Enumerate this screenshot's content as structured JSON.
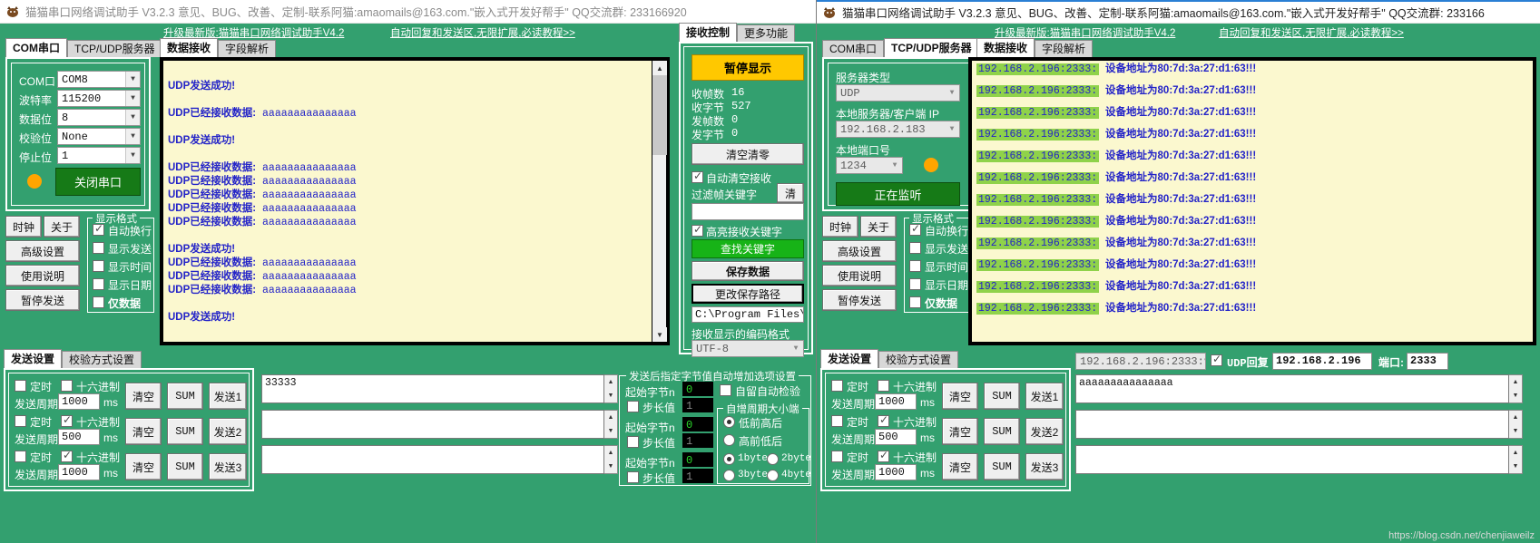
{
  "window_left": {
    "title": "猫猫串口网络调试助手 V3.2.3 意见、BUG、改善、定制-联系阿猫:amaomails@163.com.\"嵌入式开发好帮手\" QQ交流群: 233166920",
    "banner": {
      "upgrade_link": "升级最新版:猫猫串口网络调试助手V4.2",
      "auto_reply_link": "自动回复和发送区,无限扩展,必读教程>>"
    },
    "conn_tabs": [
      {
        "label": "COM串口",
        "active": true
      },
      {
        "label": "TCP/UDP服务器",
        "active": false
      }
    ],
    "serial": {
      "fields": [
        {
          "label": "COM口",
          "value": "COM8"
        },
        {
          "label": "波特率",
          "value": "115200"
        },
        {
          "label": "数据位",
          "value": "8"
        },
        {
          "label": "校验位",
          "value": "None"
        },
        {
          "label": "停止位",
          "value": "1"
        }
      ],
      "connect_button": "关闭串口",
      "led_color": "#ffa500"
    },
    "side_buttons": [
      "时钟",
      "关于",
      "高级设置",
      "使用说明",
      "暂停发送"
    ],
    "display_format": {
      "title": "显示格式",
      "options": [
        {
          "label": "自动换行",
          "checked": true
        },
        {
          "label": "显示发送",
          "checked": false
        },
        {
          "label": "显示时间",
          "checked": false
        },
        {
          "label": "显示日期",
          "checked": false
        },
        {
          "label": "仅数据",
          "checked": false,
          "bold": true
        }
      ]
    },
    "data_tabs": [
      {
        "label": "数据接收",
        "active": true
      },
      {
        "label": "字段解析",
        "active": false
      }
    ],
    "log_lines": [
      {
        "type": "blank"
      },
      {
        "type": "send",
        "text": "UDP发送成功!"
      },
      {
        "type": "blank"
      },
      {
        "type": "recv",
        "prefix": "UDP已经接收数据:",
        "data": "aaaaaaaaaaaaaaa"
      },
      {
        "type": "blank"
      },
      {
        "type": "send",
        "text": "UDP发送成功!"
      },
      {
        "type": "blank"
      },
      {
        "type": "recv",
        "prefix": "UDP已经接收数据:",
        "data": "aaaaaaaaaaaaaaa"
      },
      {
        "type": "recv",
        "prefix": "UDP已经接收数据:",
        "data": "aaaaaaaaaaaaaaa"
      },
      {
        "type": "recv",
        "prefix": "UDP已经接收数据:",
        "data": "aaaaaaaaaaaaaaa"
      },
      {
        "type": "recv",
        "prefix": "UDP已经接收数据:",
        "data": "aaaaaaaaaaaaaaa"
      },
      {
        "type": "recv",
        "prefix": "UDP已经接收数据:",
        "data": "aaaaaaaaaaaaaaa"
      },
      {
        "type": "blank"
      },
      {
        "type": "send",
        "text": "UDP发送成功!"
      },
      {
        "type": "recv",
        "prefix": "UDP已经接收数据:",
        "data": "aaaaaaaaaaaaaaa"
      },
      {
        "type": "recv",
        "prefix": "UDP已经接收数据:",
        "data": "aaaaaaaaaaaaaaa"
      },
      {
        "type": "recv",
        "prefix": "UDP已经接收数据:",
        "data": "aaaaaaaaaaaaaaa"
      },
      {
        "type": "blank"
      },
      {
        "type": "send",
        "text": "UDP发送成功!"
      }
    ],
    "recv_tabs": [
      {
        "label": "接收控制",
        "active": true
      },
      {
        "label": "更多功能",
        "active": false
      }
    ],
    "recv_ctrl": {
      "pause_button": "暂停显示",
      "stats": [
        {
          "label": "收帧数",
          "value": "16"
        },
        {
          "label": "收字节",
          "value": "527"
        },
        {
          "label": "发帧数",
          "value": "0"
        },
        {
          "label": "发字节",
          "value": "0"
        }
      ],
      "clear_button": "清空清零",
      "auto_clear": {
        "label": "自动清空接收",
        "checked": true
      },
      "filter_label": "过滤帧关键字",
      "filter_clear_button": "清",
      "filter_value": "",
      "highlight": {
        "label": "高亮接收关键字",
        "checked": true
      },
      "find_button": "查找关键字",
      "save_button": "保存数据",
      "path_button": "更改保存路径",
      "path_value": "C:\\Program Files\\dat",
      "encoding_label": "接收显示的编码格式",
      "encoding_value": "UTF-8"
    },
    "bottom_tabs": [
      {
        "label": "发送设置",
        "active": true
      },
      {
        "label": "校验方式设置",
        "active": false
      }
    ],
    "send_rows": [
      {
        "timer": {
          "label": "定时",
          "checked": false
        },
        "hex": {
          "label": "十六进制",
          "checked": false
        },
        "period_label": "发送周期",
        "period": "1000",
        "unit": "ms",
        "clear": "清空",
        "sum": "SUM",
        "send": "发送1",
        "payload": "33333"
      },
      {
        "timer": {
          "label": "定时",
          "checked": false
        },
        "hex": {
          "label": "十六进制",
          "checked": true
        },
        "period_label": "发送周期",
        "period": "500",
        "unit": "ms",
        "clear": "清空",
        "sum": "SUM",
        "send": "发送2",
        "payload": ""
      },
      {
        "timer": {
          "label": "定时",
          "checked": false
        },
        "hex": {
          "label": "十六进制",
          "checked": true
        },
        "period_label": "发送周期",
        "period": "1000",
        "unit": "ms",
        "clear": "清空",
        "sum": "SUM",
        "send": "发送3",
        "payload": ""
      }
    ],
    "auto_inc": {
      "title": "发送后指定字节值自动增加选项设置",
      "rows": [
        {
          "start_label": "起始字节n",
          "start": "0",
          "step_label": "步长值",
          "step": "1",
          "step_checked": false
        },
        {
          "start_label": "起始字节n",
          "start": "0",
          "step_label": "步长值",
          "step": "1",
          "step_checked": false
        },
        {
          "start_label": "起始字节n",
          "start": "0",
          "step_label": "步长值",
          "step": "1",
          "step_checked": false
        }
      ],
      "auto_check": {
        "label": "自留自动检验",
        "checked": false
      },
      "period_group_title": "自增周期大小端",
      "endian": [
        {
          "label": "低前高后",
          "checked": true
        },
        {
          "label": "高前低后",
          "checked": false
        }
      ],
      "bytes": [
        {
          "label": "1byte",
          "checked": true
        },
        {
          "label": "2byte",
          "checked": false
        },
        {
          "label": "3byte",
          "checked": false
        },
        {
          "label": "4byte",
          "checked": false
        }
      ]
    }
  },
  "window_right": {
    "title": "猫猫串口网络调试助手 V3.2.3 意见、BUG、改善、定制-联系阿猫:amaomails@163.com.\"嵌入式开发好帮手\" QQ交流群: 233166",
    "banner": {
      "upgrade_link": "升级最新版:猫猫串口网络调试助手V4.2",
      "auto_reply_link": "自动回复和发送区,无限扩展,必读教程>>"
    },
    "conn_tabs": [
      {
        "label": "COM串口",
        "active": false
      },
      {
        "label": "TCP/UDP服务器",
        "active": true
      }
    ],
    "net": {
      "server_type_label": "服务器类型",
      "server_type": "UDP",
      "local_ip_label": "本地服务器/客户端 IP",
      "local_ip": "192.168.2.183",
      "local_port_label": "本地端口号",
      "local_port": "1234",
      "listen_button": "正在监听",
      "led_color": "#ffa500"
    },
    "side_buttons": [
      "时钟",
      "关于",
      "高级设置",
      "使用说明",
      "暂停发送"
    ],
    "display_format": {
      "title": "显示格式",
      "options": [
        {
          "label": "自动换行",
          "checked": true
        },
        {
          "label": "显示发送",
          "checked": false
        },
        {
          "label": "显示时间",
          "checked": false
        },
        {
          "label": "显示日期",
          "checked": false
        },
        {
          "label": "仅数据",
          "checked": false,
          "bold": true
        }
      ]
    },
    "data_tabs": [
      {
        "label": "数据接收",
        "active": true
      },
      {
        "label": "字段解析",
        "active": false
      }
    ],
    "log_lines": [
      {
        "addr": "192.168.2.196:2333:",
        "text": "设备地址为80:7d:3a:27:d1:63!!!"
      },
      {
        "addr": "192.168.2.196:2333:",
        "text": "设备地址为80:7d:3a:27:d1:63!!!"
      },
      {
        "addr": "192.168.2.196:2333:",
        "text": "设备地址为80:7d:3a:27:d1:63!!!"
      },
      {
        "addr": "192.168.2.196:2333:",
        "text": "设备地址为80:7d:3a:27:d1:63!!!"
      },
      {
        "addr": "192.168.2.196:2333:",
        "text": "设备地址为80:7d:3a:27:d1:63!!!"
      },
      {
        "addr": "192.168.2.196:2333:",
        "text": "设备地址为80:7d:3a:27:d1:63!!!"
      },
      {
        "addr": "192.168.2.196:2333:",
        "text": "设备地址为80:7d:3a:27:d1:63!!!"
      },
      {
        "addr": "192.168.2.196:2333:",
        "text": "设备地址为80:7d:3a:27:d1:63!!!"
      },
      {
        "addr": "192.168.2.196:2333:",
        "text": "设备地址为80:7d:3a:27:d1:63!!!"
      },
      {
        "addr": "192.168.2.196:2333:",
        "text": "设备地址为80:7d:3a:27:d1:63!!!"
      },
      {
        "addr": "192.168.2.196:2333:",
        "text": "设备地址为80:7d:3a:27:d1:63!!!"
      },
      {
        "addr": "192.168.2.196:2333:",
        "text": "设备地址为80:7d:3a:27:d1:63!!!"
      }
    ],
    "bottom_tabs": [
      {
        "label": "发送设置",
        "active": true
      },
      {
        "label": "校验方式设置",
        "active": false
      }
    ],
    "send_rows": [
      {
        "timer": {
          "label": "定时",
          "checked": false
        },
        "hex": {
          "label": "十六进制",
          "checked": false
        },
        "period_label": "发送周期",
        "period": "1000",
        "unit": "ms",
        "clear": "清空",
        "sum": "SUM",
        "send": "发送1",
        "payload": "aaaaaaaaaaaaaaa"
      },
      {
        "timer": {
          "label": "定时",
          "checked": false
        },
        "hex": {
          "label": "十六进制",
          "checked": true
        },
        "period_label": "发送周期",
        "period": "500",
        "unit": "ms",
        "clear": "清空",
        "sum": "SUM",
        "send": "发送2",
        "payload": ""
      },
      {
        "timer": {
          "label": "定时",
          "checked": false
        },
        "hex": {
          "label": "十六进制",
          "checked": true
        },
        "period_label": "发送周期",
        "period": "1000",
        "unit": "ms",
        "clear": "清空",
        "sum": "SUM",
        "send": "发送3",
        "payload": ""
      }
    ],
    "target": {
      "peer_select": "192.168.2.196:2333:",
      "udp_reply": {
        "label": "UDP回复",
        "checked": true
      },
      "ip_value": "192.168.2.196",
      "port_label": "端口:",
      "port_value": "2333"
    },
    "watermark": "https://blog.csdn.net/chenjiaweilz"
  }
}
